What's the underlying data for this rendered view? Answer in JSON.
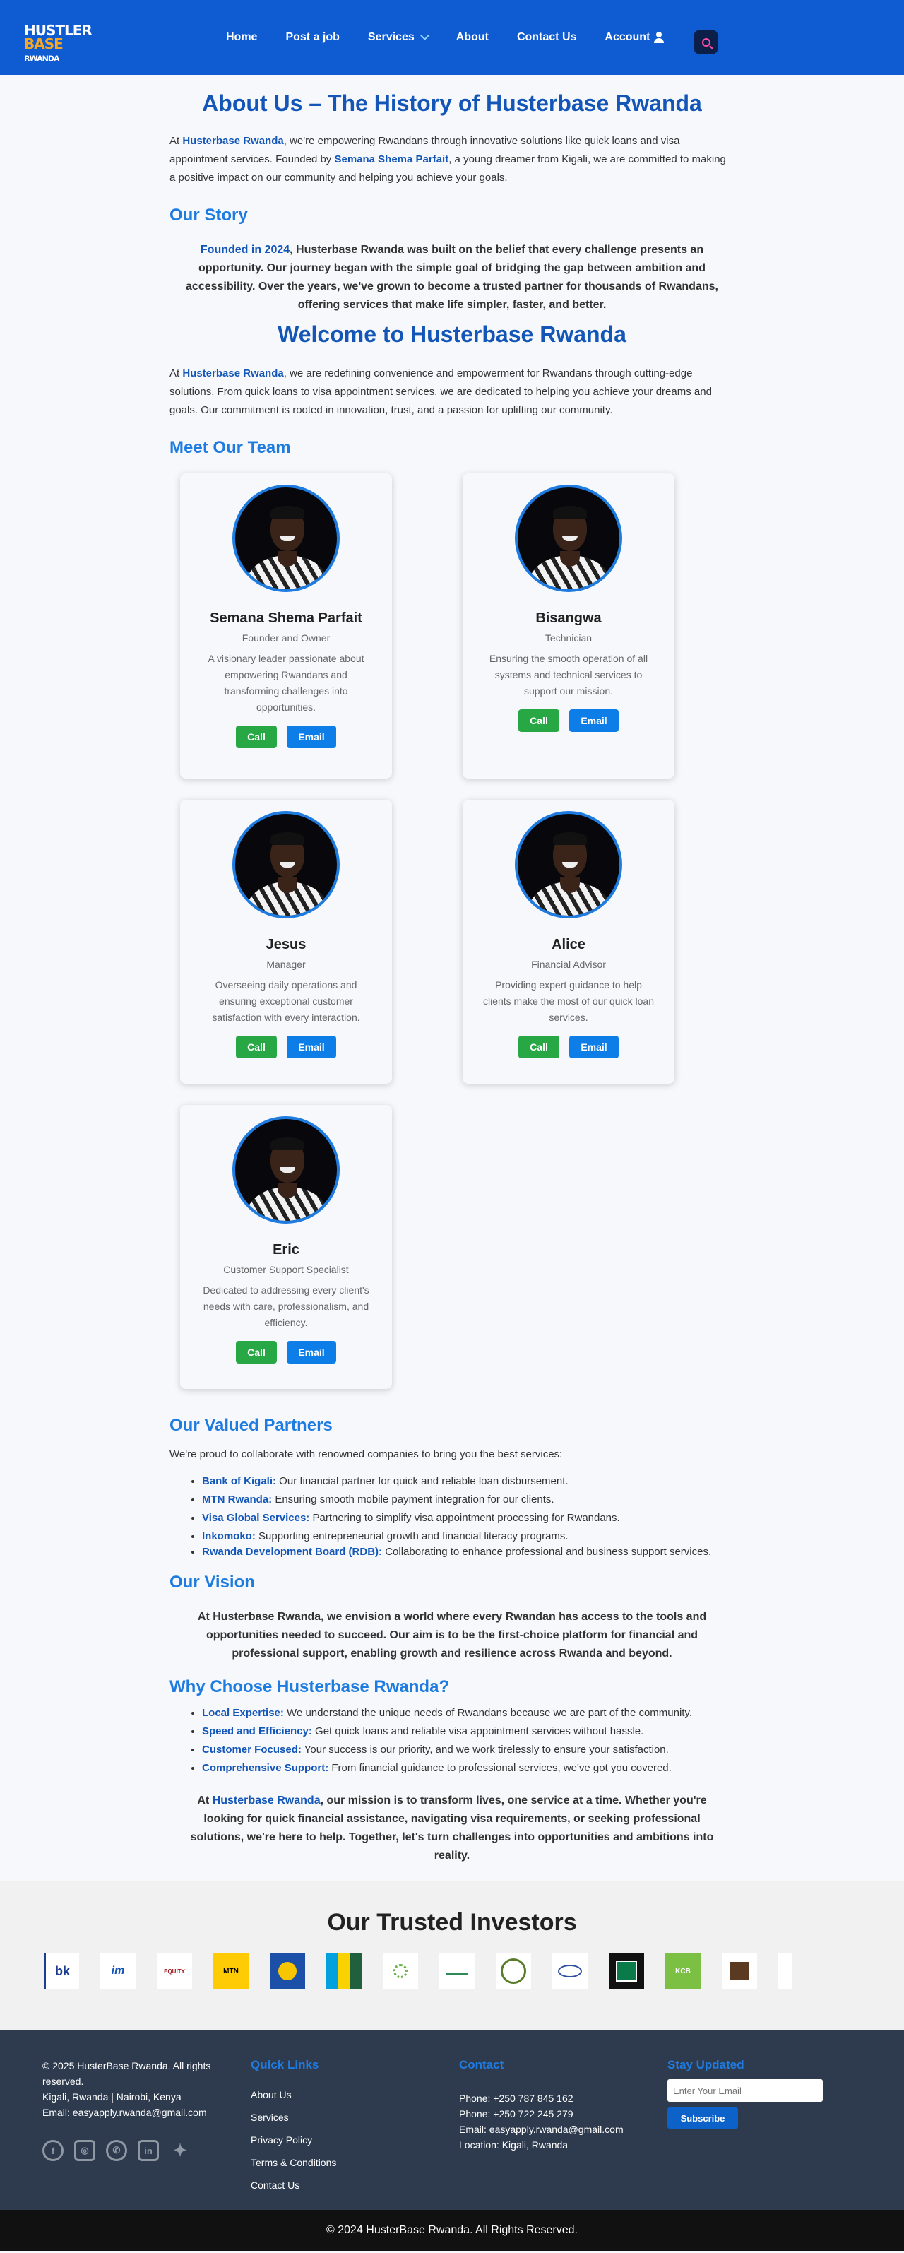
{
  "header": {
    "logo_line1": "HUSTLER",
    "logo_line2": "BASE",
    "logo_small": "RWANDA",
    "nav": [
      "Home",
      "Post a job",
      "Services",
      "About",
      "Contact Us",
      "Account"
    ]
  },
  "about": {
    "title": "About Us – The History of Husterbase Rwanda",
    "p1_a": "At ",
    "p1_brand": "Husterbase Rwanda",
    "p1_b": ", we're empowering Rwandans through innovative solutions like quick loans and visa appointment services. Founded by ",
    "p1_founder": "Semana Shema Parfait",
    "p1_c": ", a young dreamer from Kigali, we are committed to making a positive impact on our community and helping you achieve your goals."
  },
  "story": {
    "heading": "Our Story",
    "lead": "Founded in 2024",
    "text": ", Husterbase Rwanda was built on the belief that every challenge presents an opportunity. Our journey began with the simple goal of bridging the gap between ambition and accessibility. Over the years, we've grown to become a trusted partner for thousands of Rwandans, offering services that make life simpler, faster, and better."
  },
  "welcome": {
    "title": "Welcome to Husterbase Rwanda",
    "p_a": "At ",
    "p_brand": "Husterbase Rwanda",
    "p_b": ", we are redefining convenience and empowerment for Rwandans through cutting-edge solutions. From quick loans to visa appointment services, we are dedicated to helping you achieve your dreams and goals. Our commitment is rooted in innovation, trust, and a passion for uplifting our community."
  },
  "team": {
    "heading": "Meet Our Team",
    "call_label": "Call",
    "email_label": "Email",
    "members": [
      {
        "name": "Semana Shema Parfait",
        "role": "Founder and Owner",
        "desc": "A visionary leader passionate about empowering Rwandans and transforming challenges into opportunities."
      },
      {
        "name": "Bisangwa",
        "role": "Technician",
        "desc": "Ensuring the smooth operation of all systems and technical services to support our mission."
      },
      {
        "name": "Jesus",
        "role": "Manager",
        "desc": "Overseeing daily operations and ensuring exceptional customer satisfaction with every interaction."
      },
      {
        "name": "Alice",
        "role": "Financial Advisor",
        "desc": "Providing expert guidance to help clients make the most of our quick loan services."
      },
      {
        "name": "Eric",
        "role": "Customer Support Specialist",
        "desc": "Dedicated to addressing every client's needs with care, professionalism, and efficiency."
      }
    ]
  },
  "partners": {
    "heading": "Our Valued Partners",
    "intro": "We're proud to collaborate with renowned companies to bring you the best services:",
    "items": [
      {
        "k": "Bank of Kigali:",
        "v": " Our financial partner for quick and reliable loan disbursement."
      },
      {
        "k": "MTN Rwanda:",
        "v": " Ensuring smooth mobile payment integration for our clients."
      },
      {
        "k": "Visa Global Services:",
        "v": " Partnering to simplify visa appointment processing for Rwandans."
      },
      {
        "k": "Inkomoko:",
        "v": " Supporting entrepreneurial growth and financial literacy programs."
      },
      {
        "k": "Rwanda Development Board (RDB):",
        "v": " Collaborating to enhance professional and business support services."
      }
    ]
  },
  "vision": {
    "heading": "Our Vision",
    "text": "At Husterbase Rwanda, we envision a world where every Rwandan has access to the tools and opportunities needed to succeed. Our aim is to be the first-choice platform for financial and professional support, enabling growth and resilience across Rwanda and beyond."
  },
  "why": {
    "heading": "Why Choose Husterbase Rwanda?",
    "items": [
      {
        "k": "Local Expertise:",
        "v": " We understand the unique needs of Rwandans because we are part of the community."
      },
      {
        "k": "Speed and Efficiency:",
        "v": " Get quick loans and reliable visa appointment services without hassle."
      },
      {
        "k": "Customer Focused:",
        "v": " Your success is our priority, and we work tirelessly to ensure your satisfaction."
      },
      {
        "k": "Comprehensive Support:",
        "v": " From financial guidance to professional services, we've got you covered."
      }
    ],
    "closing_a": "At ",
    "closing_brand": "Husterbase Rwanda",
    "closing_b": ", our mission is to transform lives, one service at a time. Whether you're looking for quick financial assistance, navigating visa requirements, or seeking professional solutions, we're here to help. Together, let's turn challenges into opportunities and ambitions into reality."
  },
  "investors": {
    "heading": "Our Trusted Investors",
    "logos": [
      "bk",
      "im",
      "EQUITY",
      "MTN",
      "",
      "",
      "",
      "",
      "",
      "",
      "",
      "KCB",
      "",
      ""
    ]
  },
  "footer": {
    "copyright": "© 2025 HusterBase Rwanda. All rights reserved.",
    "location": "Kigali, Rwanda | Nairobi, Kenya",
    "email": "Email: easyapply.rwanda@gmail.com",
    "quick_heading": "Quick Links",
    "links": [
      "About Us",
      "Services",
      "Privacy Policy",
      "Terms & Conditions",
      "Contact Us"
    ],
    "contact_heading": "Contact",
    "phone1": "Phone: +250 787 845 162",
    "phone2": "Phone: +250 722 245 279",
    "contact_email": "Email: easyapply.rwanda@gmail.com",
    "contact_location": "Location: Kigali, Rwanda",
    "updated_heading": "Stay Updated",
    "email_placeholder": "Enter Your Email",
    "subscribe": "Subscribe",
    "bottom": "© 2024 HusterBase Rwanda. All Rights Reserved."
  }
}
